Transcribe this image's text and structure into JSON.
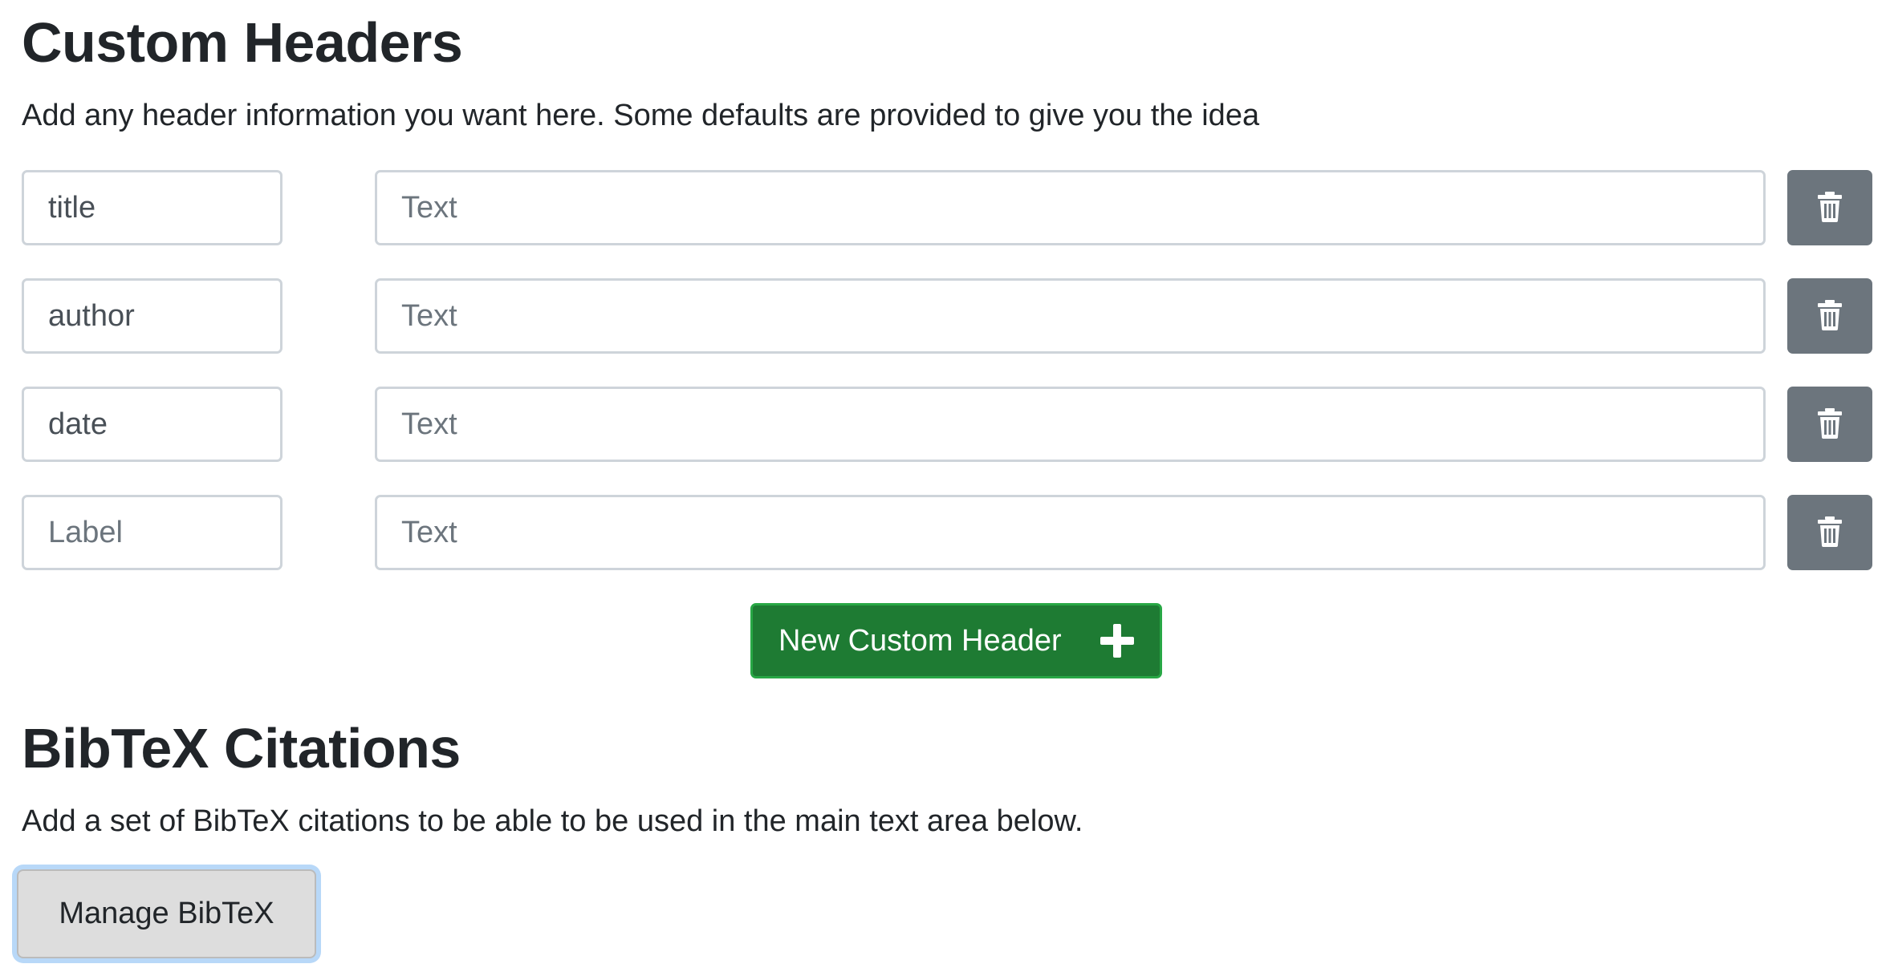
{
  "custom_headers": {
    "title": "Custom Headers",
    "description": "Add any header information you want here. Some defaults are provided to give you the idea",
    "rows": [
      {
        "label_value": "title",
        "label_placeholder": "Label",
        "text_value": "",
        "text_placeholder": "Text"
      },
      {
        "label_value": "author",
        "label_placeholder": "Label",
        "text_value": "",
        "text_placeholder": "Text"
      },
      {
        "label_value": "date",
        "label_placeholder": "Label",
        "text_value": "",
        "text_placeholder": "Text"
      },
      {
        "label_value": "",
        "label_placeholder": "Label",
        "text_value": "",
        "text_placeholder": "Text"
      }
    ],
    "new_button_label": "New Custom Header",
    "delete_icon": "trash-icon",
    "add_icon": "plus-icon"
  },
  "bibtex": {
    "title": "BibTeX Citations",
    "description": "Add a set of BibTeX citations to be able to be used in the main text area below.",
    "manage_button_label": "Manage BibTeX"
  },
  "colors": {
    "primary_text": "#212529",
    "delete_button": "#6c757d",
    "new_button": "#1e7b33",
    "new_button_border": "#28a745",
    "manage_button_bg": "#dddddd",
    "focus_ring": "#b8d8f8"
  }
}
